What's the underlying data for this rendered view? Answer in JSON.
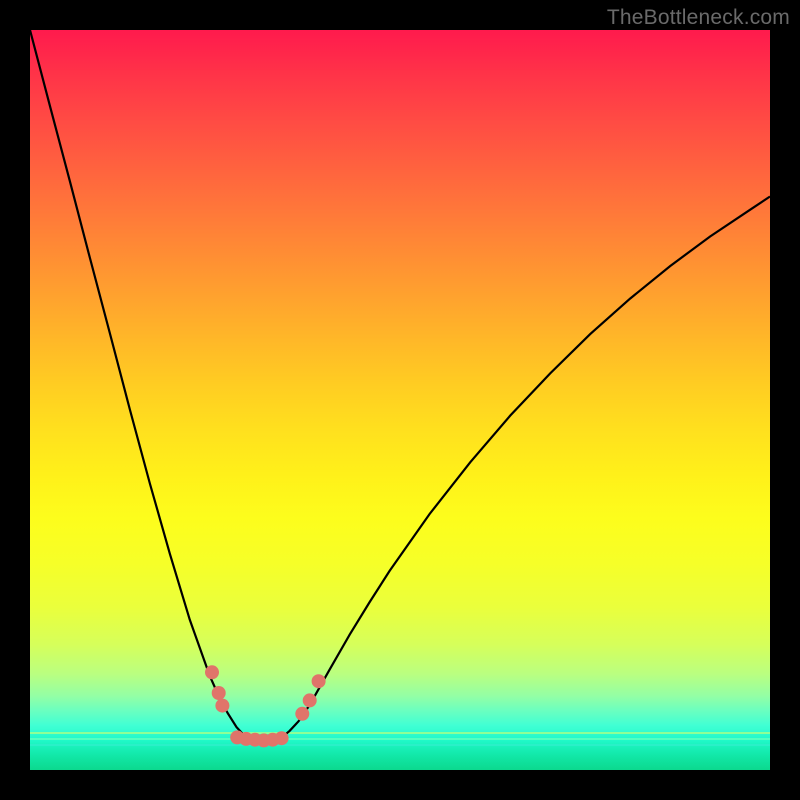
{
  "watermark": "TheBottleneck.com",
  "colors": {
    "background": "#000000",
    "gradient_top": "#ff1a4d",
    "gradient_bottom": "#0cd98e",
    "curve": "#000000",
    "marker": "#e0746a"
  },
  "chart_data": {
    "type": "line",
    "title": "",
    "xlabel": "",
    "ylabel": "",
    "xlim": [
      0,
      1
    ],
    "ylim": [
      0,
      1
    ],
    "note": "No axis ticks or numeric labels are rendered. Curve values are the visible pixel-trace normalized to [0,1] with the minimum (≈0) located near x≈0.31. Y increases downward visually; listed y is the approximate vertical position from top in the plot area.",
    "series": [
      {
        "name": "bottleneck-curve",
        "x": [
          0.0,
          0.027,
          0.054,
          0.081,
          0.108,
          0.135,
          0.162,
          0.189,
          0.216,
          0.243,
          0.255,
          0.267,
          0.279,
          0.291,
          0.303,
          0.315,
          0.327,
          0.339,
          0.351,
          0.363,
          0.378,
          0.405,
          0.432,
          0.459,
          0.486,
          0.54,
          0.595,
          0.649,
          0.703,
          0.757,
          0.811,
          0.865,
          0.919,
          0.973,
          1.0
        ],
        "y": [
          0.0,
          0.103,
          0.205,
          0.308,
          0.41,
          0.513,
          0.613,
          0.708,
          0.797,
          0.873,
          0.9,
          0.923,
          0.942,
          0.955,
          0.962,
          0.963,
          0.962,
          0.957,
          0.947,
          0.934,
          0.912,
          0.864,
          0.817,
          0.773,
          0.731,
          0.654,
          0.584,
          0.521,
          0.464,
          0.411,
          0.363,
          0.319,
          0.279,
          0.243,
          0.225
        ]
      }
    ],
    "markers": {
      "description": "Salmon dots clustered near the curve minimum",
      "points_xy": [
        [
          0.246,
          0.868
        ],
        [
          0.255,
          0.896
        ],
        [
          0.26,
          0.913
        ],
        [
          0.28,
          0.956
        ],
        [
          0.292,
          0.958
        ],
        [
          0.304,
          0.959
        ],
        [
          0.316,
          0.96
        ],
        [
          0.328,
          0.959
        ],
        [
          0.34,
          0.957
        ],
        [
          0.368,
          0.924
        ],
        [
          0.378,
          0.906
        ],
        [
          0.39,
          0.88
        ]
      ],
      "radius_px": 7
    }
  }
}
